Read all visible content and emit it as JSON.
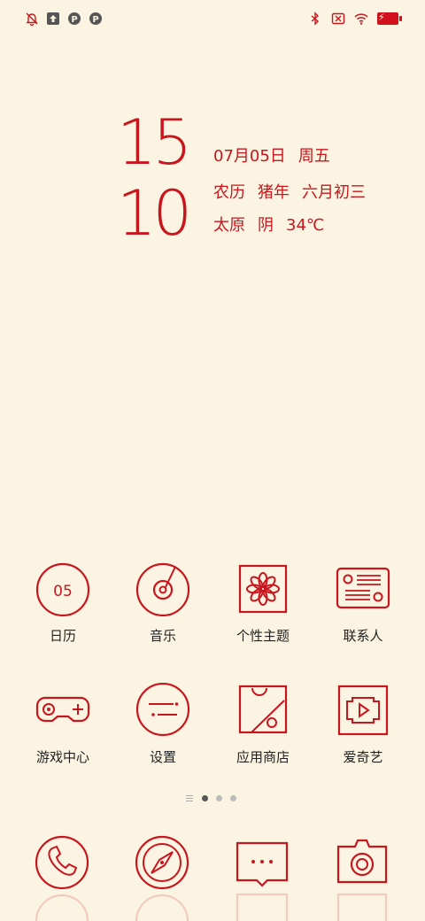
{
  "status_bar": {
    "left_icons": [
      "bell-off-icon",
      "upload-icon",
      "p-icon",
      "p-icon"
    ],
    "right_icons": [
      "bluetooth-icon",
      "no-sim-icon",
      "wifi-icon",
      "battery-icon"
    ]
  },
  "clock": {
    "hour": "15",
    "minute": "10"
  },
  "date_info": {
    "date": "07月05日",
    "weekday": "周五",
    "lunar_label": "农历",
    "lunar_year": "猪年",
    "lunar_date": "六月初三",
    "city": "太原",
    "weather": "阴",
    "temperature": "34℃"
  },
  "apps": [
    {
      "label": "日历",
      "icon": "calendar-icon",
      "icon_text": "05"
    },
    {
      "label": "音乐",
      "icon": "music-icon"
    },
    {
      "label": "个性主题",
      "icon": "theme-icon"
    },
    {
      "label": "联系人",
      "icon": "contacts-icon"
    },
    {
      "label": "游戏中心",
      "icon": "gamepad-icon"
    },
    {
      "label": "设置",
      "icon": "settings-icon"
    },
    {
      "label": "应用商店",
      "icon": "app-store-icon"
    },
    {
      "label": "爱奇艺",
      "icon": "iqiyi-icon"
    }
  ],
  "page_indicator": {
    "current": 1,
    "count": 3
  },
  "dock": [
    {
      "icon": "phone-icon"
    },
    {
      "icon": "browser-compass-icon"
    },
    {
      "icon": "messages-icon"
    },
    {
      "icon": "camera-icon"
    }
  ],
  "colors": {
    "accent": "#c8161e",
    "background": "#fcf4e2",
    "label": "#222222"
  }
}
